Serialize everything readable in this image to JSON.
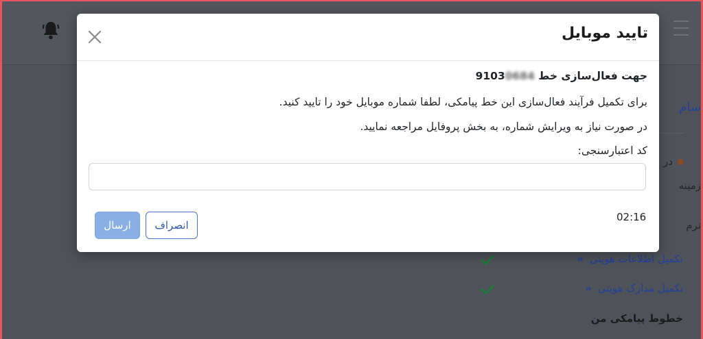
{
  "modal": {
    "title": "تایید موبایل",
    "line_heading": "جهت فعال‌سازی خط",
    "number_visible": "9103",
    "number_blurred": "0684",
    "line_instruction": "برای تکمیل فرآیند فعال‌سازی این خط پیامکی، لطفا شماره موبایل خود را تایید کنید.",
    "line_edit": "در صورت نیاز به ویرایش شماره، به بخش پروفایل مراجعه نمایید.",
    "code_label": "کد اعتبارسنجی:",
    "code_value": "",
    "timer": "02:16",
    "cancel_label": "انصراف",
    "send_label": "ارسال"
  },
  "background": {
    "header_partial": "سام",
    "item1_partial": "در",
    "item2_partial": "زمینه",
    "item3_partial": "نرم",
    "link1": "تکمیل اطلاعات هویتی",
    "link2": "تکمیل مدارک هویتی",
    "link_arrow": "«",
    "section_title": "خطوط پیامکی من"
  },
  "icons": {
    "bell": "bell-icon",
    "menu": "hamburger-menu-icon",
    "close": "close-icon",
    "check": "check-icon"
  },
  "colors": {
    "overlay": "#50525a",
    "frame": "#e8555b",
    "primary": "#4b77c4",
    "primary_disabled": "#8aaee6",
    "success": "#1f7a3a",
    "link": "#24419a"
  }
}
